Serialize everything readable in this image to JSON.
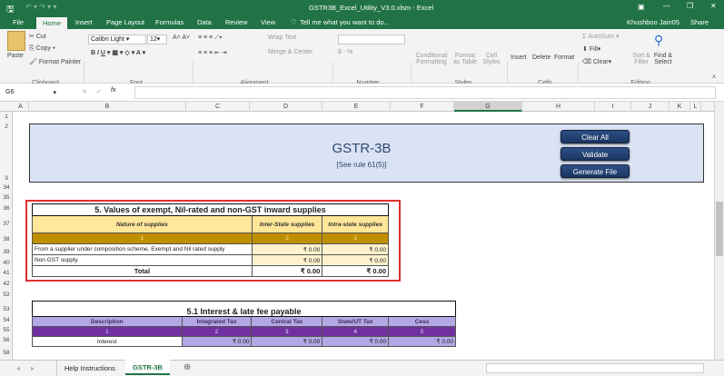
{
  "window": {
    "title": "GSTR3B_Excel_Utility_V3.0.xlsm - Excel",
    "user": "Khushboo Jain05",
    "share": "Share"
  },
  "ribbon_tabs": [
    "File",
    "Home",
    "Insert",
    "Page Layout",
    "Formulas",
    "Data",
    "Review",
    "View"
  ],
  "tell_me": "Tell me what you want to do...",
  "clipboard": {
    "paste": "Paste",
    "cut": "Cut",
    "copy": "Copy",
    "format_painter": "Format Painter",
    "label": "Clipboard"
  },
  "font": {
    "name": "Calibri Light",
    "size": "12",
    "label": "Font"
  },
  "alignment": {
    "wrap": "Wrap Text",
    "merge": "Merge & Center",
    "label": "Alignment"
  },
  "number": {
    "label": "Number",
    "currency": "$ - %"
  },
  "styles": {
    "conditional": "Conditional Formatting",
    "format_table": "Format as Table",
    "cell_styles": "Cell Styles",
    "label": "Styles"
  },
  "cells": {
    "insert": "Insert",
    "delete": "Delete",
    "format": "Format",
    "label": "Cells"
  },
  "editing": {
    "autosum": "AutoSum",
    "fill": "Fill",
    "clear": "Clear",
    "sort": "Sort & Filter",
    "find": "Find & Select",
    "label": "Editing"
  },
  "formula_bar": {
    "name_box": "G6",
    "fx": "fx",
    "value": ""
  },
  "columns": [
    "A",
    "B",
    "C",
    "D",
    "E",
    "F",
    "G",
    "H",
    "I",
    "J",
    "K",
    "L"
  ],
  "rows": [
    "1",
    "2",
    "3",
    "34",
    "35",
    "36",
    "37",
    "38",
    "39",
    "40",
    "41",
    "42",
    "52",
    "53",
    "54",
    "55",
    "56",
    "58"
  ],
  "header": {
    "title": "GSTR-3B",
    "subtitle": "[See rule 61(5)]",
    "buttons": [
      "Clear All",
      "Validate",
      "Generate File"
    ]
  },
  "table5": {
    "title": "5. Values of exempt, Nil-rated and non-GST inward supplies",
    "headers": [
      "Nature of supplies",
      "Inter-State supplies",
      "Intra-state supplies"
    ],
    "numbers": [
      "1",
      "2",
      "3"
    ],
    "rows": [
      [
        "From a supplier under composition scheme, Exempt  and Nil rated supply",
        "₹ 0.00",
        "₹ 0.00"
      ],
      [
        "Non GST supply",
        "₹ 0.00",
        "₹ 0.00"
      ]
    ],
    "total": [
      "Total",
      "₹ 0.00",
      "₹ 0.00"
    ]
  },
  "table51": {
    "title": "5.1 Interest & late fee payable",
    "headers": [
      "Description",
      "Integrated Tax",
      "Central Tax",
      "State/UT Tax",
      "Cess"
    ],
    "numbers": [
      "1",
      "2",
      "3",
      "4",
      "5"
    ],
    "rows": [
      [
        "Interest",
        "₹ 0.00",
        "₹ 0.00",
        "₹ 0.00",
        "₹ 0.00"
      ]
    ]
  },
  "sheet_tabs": [
    "Help Instructions",
    "GSTR-3B"
  ],
  "active_sheet": "GSTR-3B",
  "colors": {
    "excel_green": "#217346",
    "gold_header": "#ffe699",
    "gold_number": "#bf8f00",
    "purple_header": "#b4a7e5",
    "purple_number": "#7030a0",
    "highlight_border": "#e03030"
  }
}
